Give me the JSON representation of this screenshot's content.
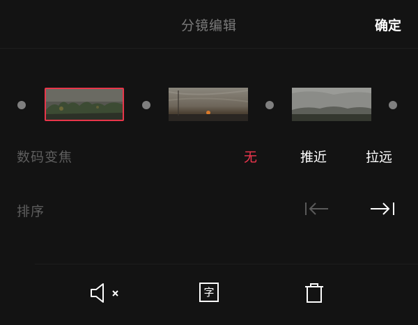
{
  "header": {
    "title": "分镜编辑",
    "confirm_label": "确定"
  },
  "timeline": {
    "clips": [
      {
        "name": "clip-1",
        "selected": true,
        "sky": "#5a5a52",
        "ground": "#3c4236"
      },
      {
        "name": "clip-2",
        "selected": false,
        "sky": "#7d7a72",
        "ground": "#2f2b25"
      },
      {
        "name": "clip-3",
        "selected": false,
        "sky": "#8a8a88",
        "ground": "#3e3f37"
      }
    ],
    "accent_color": "#e8364a"
  },
  "zoom": {
    "label": "数码变焦",
    "options": [
      "无",
      "推近",
      "拉远"
    ],
    "selected": "无"
  },
  "order": {
    "label": "排序",
    "move_first_icon": "move-to-start-icon",
    "move_last_icon": "move-to-end-icon"
  },
  "toolbar": {
    "mute_icon": "speaker-mute-icon",
    "text_icon_char": "字",
    "delete_icon": "trash-icon"
  }
}
